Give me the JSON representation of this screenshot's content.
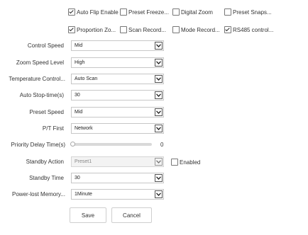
{
  "checkbox_row1": [
    {
      "label": "Auto Flip Enable",
      "checked": true
    },
    {
      "label": "Preset Freeze...",
      "checked": false
    },
    {
      "label": "Digital Zoom",
      "checked": false
    },
    {
      "label": "Preset Snaps...",
      "checked": false
    }
  ],
  "checkbox_row2": [
    {
      "label": "Proportion Zo...",
      "checked": true
    },
    {
      "label": "Scan Record...",
      "checked": false
    },
    {
      "label": "Mode Record...",
      "checked": false
    },
    {
      "label": "RS485 control...",
      "checked": true
    }
  ],
  "fields": {
    "control_speed": {
      "label": "Control Speed",
      "value": "Mid"
    },
    "zoom_speed_level": {
      "label": "Zoom Speed Level",
      "value": "High"
    },
    "temperature_control": {
      "label": "Temperature Control...",
      "value": "Auto Scan"
    },
    "auto_stop_time": {
      "label": "Auto Stop-time(s)",
      "value": "30"
    },
    "preset_speed": {
      "label": "Preset Speed",
      "value": "Mid"
    },
    "pt_first": {
      "label": "P/T First",
      "value": "Network"
    },
    "standby_action": {
      "label": "Standby Action",
      "value": "Preset1",
      "enabled_label": "Enabled",
      "enabled_checked": false
    },
    "standby_time": {
      "label": "Standby Time",
      "value": "30"
    },
    "power_lost_memory": {
      "label": "Power-lost Memory...",
      "value": "1Minute"
    }
  },
  "priority_delay": {
    "label": "Priority Delay Time(s)",
    "value": "0",
    "fraction": 0.0
  },
  "buttons": {
    "save": "Save",
    "cancel": "Cancel"
  }
}
